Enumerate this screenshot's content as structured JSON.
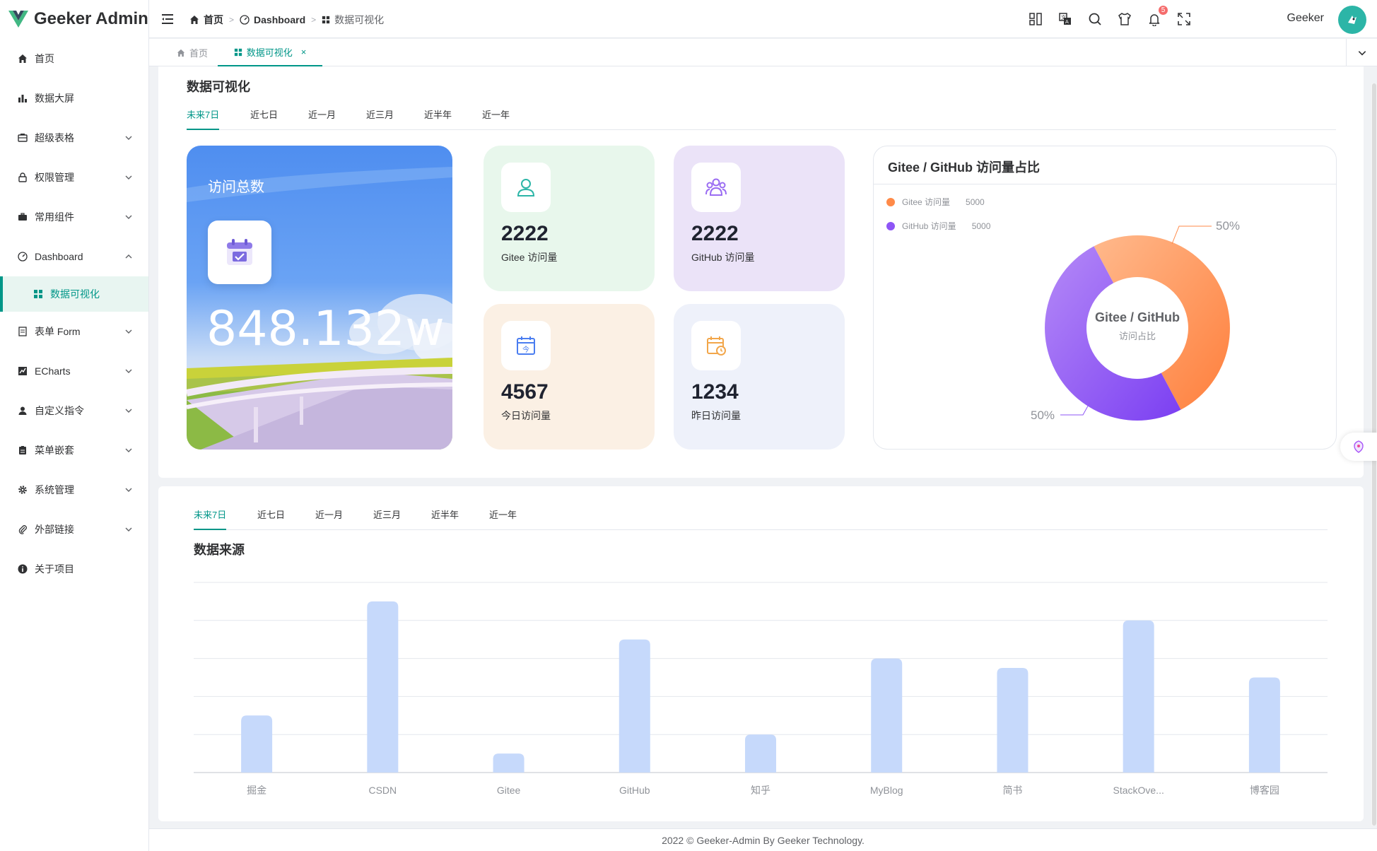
{
  "app": {
    "title": "Geeker Admin"
  },
  "colors": {
    "primary": "#009688",
    "gitee": "#ff8a48",
    "github": "#8e55f6",
    "bar": "#c6d9fb"
  },
  "sidebar": {
    "items": [
      {
        "label": "首页",
        "icon": "home-icon"
      },
      {
        "label": "数据大屏",
        "icon": "bar-chart-icon"
      },
      {
        "label": "超级表格",
        "icon": "table-icon"
      },
      {
        "label": "权限管理",
        "icon": "lock-icon"
      },
      {
        "label": "常用组件",
        "icon": "briefcase-icon"
      },
      {
        "label": "Dashboard",
        "icon": "dashboard-icon"
      },
      {
        "label": "数据可视化",
        "icon": "grid-icon"
      },
      {
        "label": "表单 Form",
        "icon": "form-icon"
      },
      {
        "label": "ECharts",
        "icon": "line-chart-icon"
      },
      {
        "label": "自定义指令",
        "icon": "user-icon"
      },
      {
        "label": "菜单嵌套",
        "icon": "clipboard-icon"
      },
      {
        "label": "系统管理",
        "icon": "gear-icon"
      },
      {
        "label": "外部链接",
        "icon": "paperclip-icon"
      },
      {
        "label": "关于项目",
        "icon": "info-icon"
      }
    ]
  },
  "header": {
    "breadcrumb": [
      "首页",
      "Dashboard",
      "数据可视化"
    ],
    "notification_count": "5",
    "username": "Geeker"
  },
  "tabs": [
    {
      "label": "首页"
    },
    {
      "label": "数据可视化",
      "close": "×"
    }
  ],
  "panel1": {
    "title": "数据可视化",
    "tabs": [
      "未来7日",
      "近七日",
      "近一月",
      "近三月",
      "近半年",
      "近一年"
    ],
    "total": {
      "label": "访问总数",
      "value": "848.132w"
    },
    "stats": [
      {
        "value": "2222",
        "label": "Gitee 访问量",
        "bg": "#e8f7ec",
        "icon": "user-icon"
      },
      {
        "value": "2222",
        "label": "GitHub 访问量",
        "bg": "#ebe3f8",
        "icon": "users-icon"
      },
      {
        "value": "4567",
        "label": "今日访问量",
        "bg": "#fbf0e4",
        "icon": "calendar-today-icon"
      },
      {
        "value": "1234",
        "label": "昨日访问量",
        "bg": "#eef1fa",
        "icon": "calendar-clock-icon"
      }
    ]
  },
  "pie": {
    "title": "Gitee / GitHub 访问量占比",
    "center_title": "Gitee / GitHub",
    "center_sub": "访问占比",
    "slices": [
      {
        "name": "Gitee 访问量",
        "value": "5000",
        "percent_label": "50%"
      },
      {
        "name": "GitHub 访问量",
        "value": "5000",
        "percent_label": "50%"
      }
    ]
  },
  "panel2": {
    "tabs": [
      "未来7日",
      "近七日",
      "近一月",
      "近三月",
      "近半年",
      "近一年"
    ],
    "title": "数据来源"
  },
  "chart_data": {
    "type": "bar",
    "categories": [
      "掘金",
      "CSDN",
      "Gitee",
      "GitHub",
      "知乎",
      "MyBlog",
      "简书",
      "StackOve...",
      "博客园"
    ],
    "values": [
      1.5,
      4.5,
      0.5,
      3.5,
      1.0,
      3.0,
      2.75,
      4.0,
      2.5
    ],
    "ylim": [
      0,
      5
    ],
    "grid": true,
    "title": "数据来源"
  },
  "footer": {
    "text": "2022 © Geeker-Admin By Geeker Technology."
  }
}
